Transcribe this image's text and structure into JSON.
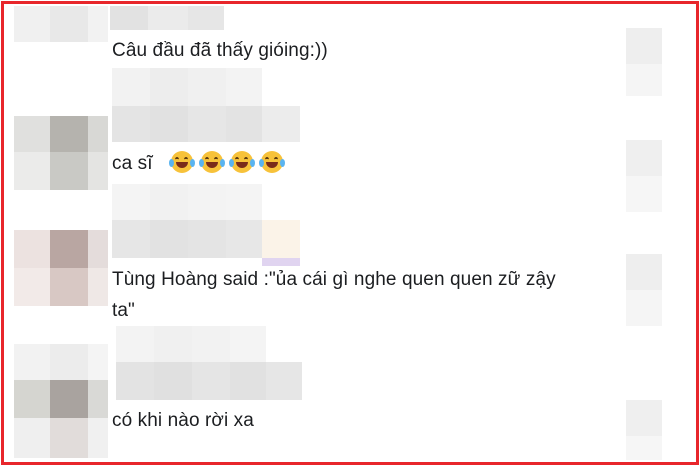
{
  "comments": [
    {
      "text": "Câu đầu đã thấy gióing:))"
    },
    {
      "text": "ca sĩ",
      "emoji_icons": [
        "laughing-crying-emoji",
        "laughing-crying-emoji",
        "laughing-crying-emoji",
        "laughing-crying-emoji"
      ]
    },
    {
      "line1": "Tùng Hoàng said :\"ủa cái gì nghe quen quen zữ zậy",
      "line2": "ta\""
    },
    {
      "text": "có khi nào rời xa"
    }
  ],
  "colors": {
    "border": "#e8262b",
    "text": "#1c1e21",
    "pixelation": "#e6e6e6"
  }
}
